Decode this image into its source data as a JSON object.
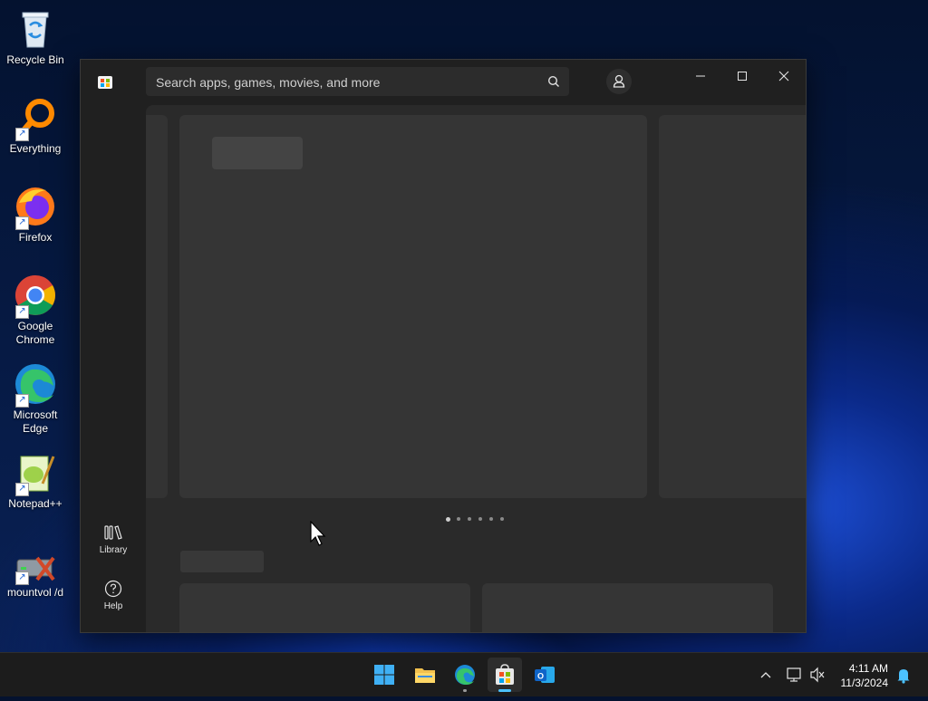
{
  "desktop": {
    "icons": [
      {
        "label": "Recycle Bin"
      },
      {
        "label": "Everything"
      },
      {
        "label": "Firefox"
      },
      {
        "label": "Google Chrome"
      },
      {
        "label": "Microsoft Edge"
      },
      {
        "label": "Notepad++"
      },
      {
        "label": "mountvol /d"
      }
    ]
  },
  "store": {
    "search_placeholder": "Search apps, games, movies, and more",
    "nav": {
      "library_label": "Library",
      "help_label": "Help"
    },
    "carousel": {
      "dot_count": 6,
      "active_index": 0
    }
  },
  "taskbar": {
    "apps": [
      "start-icon",
      "file-explorer-icon",
      "edge-icon",
      "microsoft-store-icon",
      "outlook-icon"
    ],
    "active_app": "microsoft-store-icon",
    "time": "4:11 AM",
    "date": "11/3/2024"
  },
  "colors": {
    "accent": "#4cc2ff",
    "window_bg": "#202020",
    "content_bg": "#2a2a2a"
  }
}
